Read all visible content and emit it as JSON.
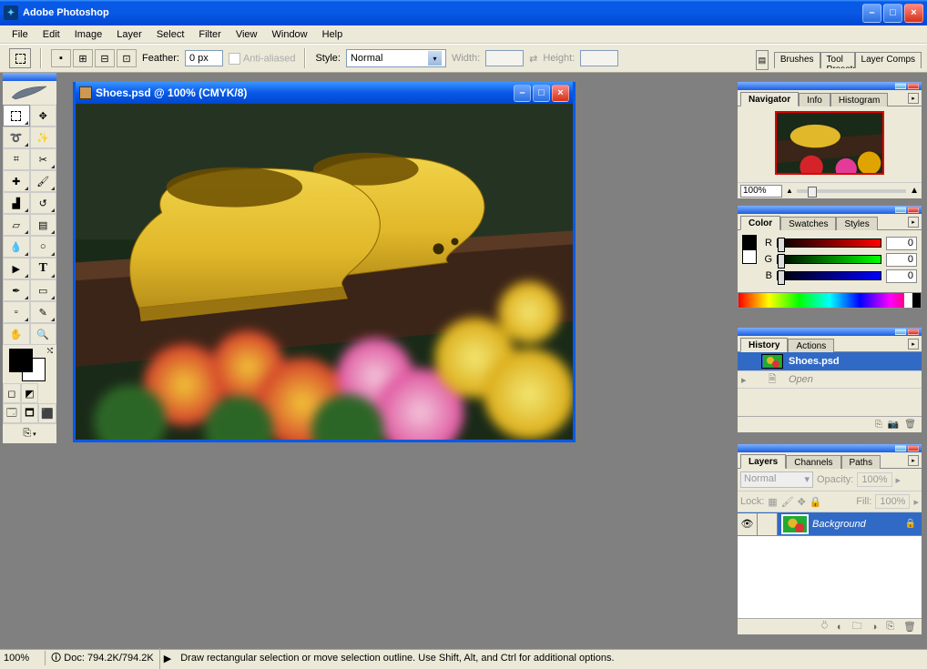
{
  "app": {
    "title": "Adobe Photoshop"
  },
  "menu": [
    "File",
    "Edit",
    "Image",
    "Layer",
    "Select",
    "Filter",
    "View",
    "Window",
    "Help"
  ],
  "options": {
    "feather_label": "Feather:",
    "feather_value": "0 px",
    "antialiased_label": "Anti-aliased",
    "style_label": "Style:",
    "style_value": "Normal",
    "width_label": "Width:",
    "height_label": "Height:",
    "side_tabs": [
      "Brushes",
      "Tool Presets",
      "Layer Comps"
    ]
  },
  "document": {
    "title": "Shoes.psd @ 100% (CMYK/8)",
    "file_name": "Shoes.psd"
  },
  "navigator": {
    "tab": "Navigator",
    "tabs_other": [
      "Info",
      "Histogram"
    ],
    "zoom": "100%"
  },
  "color": {
    "tab": "Color",
    "tabs_other": [
      "Swatches",
      "Styles"
    ],
    "channels": {
      "r_label": "R",
      "g_label": "G",
      "b_label": "B",
      "r": "0",
      "g": "0",
      "b": "0"
    }
  },
  "history": {
    "tab": "History",
    "tabs_other": [
      "Actions"
    ],
    "snapshot": "Shoes.psd",
    "step": "Open"
  },
  "layers": {
    "tab": "Layers",
    "tabs_other": [
      "Channels",
      "Paths"
    ],
    "mode": "Normal",
    "opacity_label": "Opacity:",
    "opacity": "100%",
    "lock_label": "Lock:",
    "fill_label": "Fill:",
    "fill": "100%",
    "layer_name": "Background"
  },
  "status": {
    "zoom": "100%",
    "doc": "Doc: 794.2K/794.2K",
    "hint": "Draw rectangular selection or move selection outline.  Use Shift, Alt, and Ctrl for additional options."
  }
}
